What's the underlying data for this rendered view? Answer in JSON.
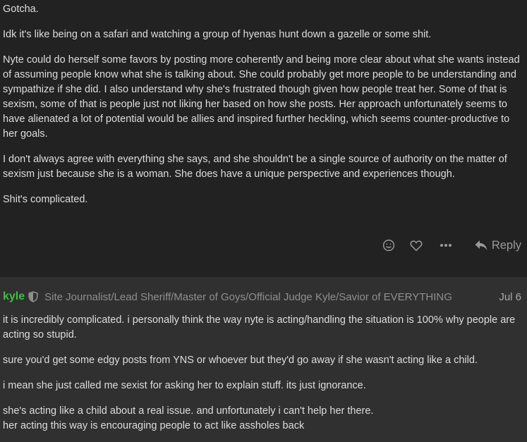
{
  "top_post": {
    "paragraphs": [
      "Gotcha.",
      "Idk it's like being on a safari and watching a group of hyenas hunt down a gazelle or some shit.",
      "Nyte could do herself some favors by posting more coherently and being more clear about what she wants instead of assuming people know what she is talking about. She could probably get more people to be understanding and sympathize if she did. I also understand why she's frustrated though given how people treat her. Some of that is sexism, some of that is people just not liking her based on how she posts. Her approach unfortunately seems to have alienated a lot of potential would be allies and inspired further heckling, which seems counter-productive to her goals.",
      "I don't always agree with everything she says, and she shouldn't be a single source of authority on the matter of sexism just because she is a woman. She does have a unique perspective and experiences though.",
      "Shit's complicated."
    ],
    "actions": {
      "emoji_icon": "smiley-icon",
      "like_icon": "heart-icon",
      "more_icon": "ellipsis-icon",
      "reply_label": "Reply"
    }
  },
  "bottom_post": {
    "username": "kyle",
    "user_title": "Site Journalist/Lead Sheriff/Master of Goys/Official Judge Kyle/Savior of EVERYTHING",
    "date": "Jul 6",
    "paragraphs": [
      "it is incredibly complicated. i personally think the way nyte is acting/handling the situation is 100% why people are acting so stupid.",
      "sure you'd get some edgy posts from YNS or whoever but they'd go away if she wasn't acting like a child.",
      "i mean she just called me sexist for asking her to explain stuff. its just ignorance.",
      "she's acting like a child about a real issue. and unfortunately i can't help her there.",
      "her acting this way is encouraging people to act like assholes back"
    ]
  },
  "colors": {
    "background": "#222222",
    "alt_background": "#303030",
    "text": "#dddddd",
    "username": "#3fbf3f",
    "muted": "#999999"
  }
}
